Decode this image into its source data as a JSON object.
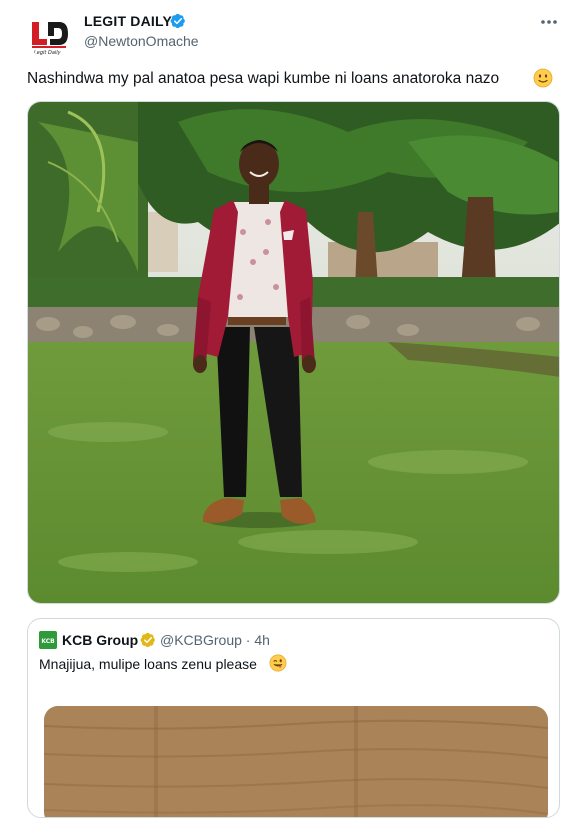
{
  "author": {
    "name": "LEGIT DAILY",
    "handle": "@NewtonOmache",
    "verified_color": "#1d9bf0",
    "avatar_icon": "legit-daily-logo"
  },
  "tweet": {
    "text": "Nashindwa my pal anatoa pesa wapi kumbe ni loans anatoroka nazo",
    "emoji": "slightly-smiling-face-icon"
  },
  "menu": {
    "icon": "more-dots-icon"
  },
  "quoted": {
    "name": "KCB Group",
    "handle_time": "@KCBGroup · 4h",
    "text": "Mnajijua, mulipe loans zenu please",
    "emoji": "winking-tongue-face-icon",
    "badge_color": "#e2b719",
    "logo_color": "#2e9a3a"
  },
  "colors": {
    "text": "#0f1419",
    "secondary": "#536471",
    "border": "#cfd9de",
    "brand_red": "#d21f26"
  }
}
